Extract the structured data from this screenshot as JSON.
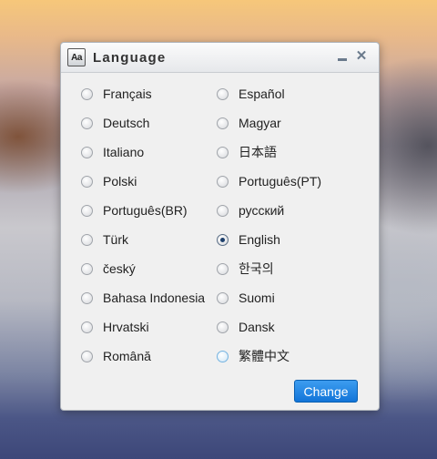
{
  "dialog": {
    "title": "Language",
    "icon_text": "Aa",
    "minimize": "minimize",
    "close": "✕"
  },
  "languages": {
    "col1": [
      {
        "label": "Français",
        "selected": false
      },
      {
        "label": "Deutsch",
        "selected": false
      },
      {
        "label": "Italiano",
        "selected": false
      },
      {
        "label": "Polski",
        "selected": false
      },
      {
        "label": "Português(BR)",
        "selected": false
      },
      {
        "label": "Türk",
        "selected": false
      },
      {
        "label": "český",
        "selected": false
      },
      {
        "label": "Bahasa Indonesia",
        "selected": false
      },
      {
        "label": "Hrvatski",
        "selected": false
      },
      {
        "label": "Română",
        "selected": false
      }
    ],
    "col2": [
      {
        "label": "Español",
        "selected": false
      },
      {
        "label": "Magyar",
        "selected": false
      },
      {
        "label": "日本語",
        "selected": false
      },
      {
        "label": "Português(PT)",
        "selected": false
      },
      {
        "label": "русский",
        "selected": false
      },
      {
        "label": "English",
        "selected": true
      },
      {
        "label": "한국의",
        "selected": false
      },
      {
        "label": "Suomi",
        "selected": false
      },
      {
        "label": "Dansk",
        "selected": false
      },
      {
        "label": "繁體中文",
        "selected": false,
        "focused": true
      }
    ]
  },
  "change_button": "Change"
}
